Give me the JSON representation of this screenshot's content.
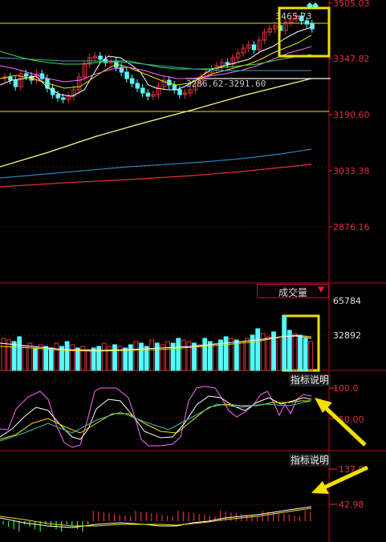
{
  "price_axis": {
    "ticks": [
      {
        "label": "3505.03",
        "value": 3505.03
      },
      {
        "label": "3347.82",
        "value": 3347.82
      },
      {
        "label": "3190.60",
        "value": 3190.6
      },
      {
        "label": "3033.38",
        "value": 3033.38
      },
      {
        "label": "2876.16",
        "value": 2876.16
      }
    ]
  },
  "price_annotations": {
    "high_label": "3465.73",
    "range_label": "3286.62-3291.60"
  },
  "volume_panel": {
    "indicator_button": "成交量",
    "dropdown_arrow": "▼",
    "ticks": [
      {
        "label": "65784",
        "value": 65784
      },
      {
        "label": "32892",
        "value": 32892
      }
    ]
  },
  "kdj_panel": {
    "explain_button": "指标说明",
    "ticks": [
      {
        "label": "100.0",
        "value": 100
      },
      {
        "label": "50.00",
        "value": 50
      }
    ]
  },
  "macd_panel": {
    "explain_button": "指标说明",
    "ticks": [
      {
        "label": "137.9",
        "value": 137.9
      },
      {
        "label": "42.98",
        "value": 42.98
      }
    ]
  },
  "colors": {
    "up": "#e0303a",
    "down": "#54ffff",
    "highlight_box": "#f0e000",
    "arrow": "#f0e000",
    "axis_text": "#e0303a",
    "panel_divider": "#b01020",
    "ma_white": "#ffffff",
    "ma_yellow": "#f0e000",
    "ma_magenta": "#ff66ff",
    "ma_green": "#40e040",
    "ma_cyan": "#40a0c0",
    "long_ma_yellow": "#ffff88",
    "long_ma_blue": "#3080c0",
    "long_ma_red": "#e0303a"
  }
}
